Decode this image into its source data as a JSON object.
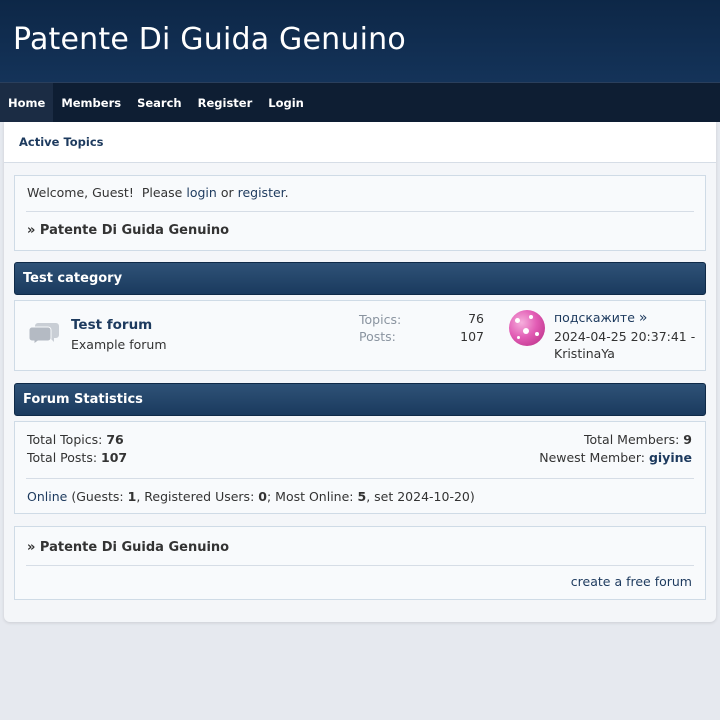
{
  "site": {
    "title": "Patente Di Guida Genuino"
  },
  "nav": {
    "items": [
      {
        "label": "Home",
        "active": true
      },
      {
        "label": "Members"
      },
      {
        "label": "Search"
      },
      {
        "label": "Register"
      },
      {
        "label": "Login"
      }
    ]
  },
  "subnav": {
    "active_topics": "Active Topics"
  },
  "welcome": {
    "greeting": "Welcome, Guest!",
    "please": "Please",
    "login": "login",
    "or": "or",
    "register": "register",
    "period": ".",
    "crumb": "» Patente Di Guida Genuino"
  },
  "category": {
    "title": "Test category",
    "forum": {
      "name": "Test forum",
      "description": "Example forum",
      "topics_label": "Topics:",
      "topics": "76",
      "posts_label": "Posts:",
      "posts": "107",
      "last_topic": "подскажите",
      "last_topic_arrow": "»",
      "last_time": "2024-04-25 20:37:41 -",
      "last_user": "KristinaYa"
    }
  },
  "stats": {
    "title": "Forum Statistics",
    "total_topics_label": "Total Topics:",
    "total_topics": "76",
    "total_posts_label": "Total Posts:",
    "total_posts": "107",
    "total_members_label": "Total Members:",
    "total_members": "9",
    "newest_member_label": "Newest Member:",
    "newest_member": "giyine",
    "online_link": "Online",
    "guests_label": "(Guests:",
    "guests": "1",
    "registered_label": ", Registered Users:",
    "registered": "0",
    "most_online_label": "; Most Online:",
    "most_online": "5",
    "most_online_date": ", set 2024-10-20)"
  },
  "footer": {
    "crumb": "» Patente Di Guida Genuino",
    "free_forum": "create a free forum"
  }
}
